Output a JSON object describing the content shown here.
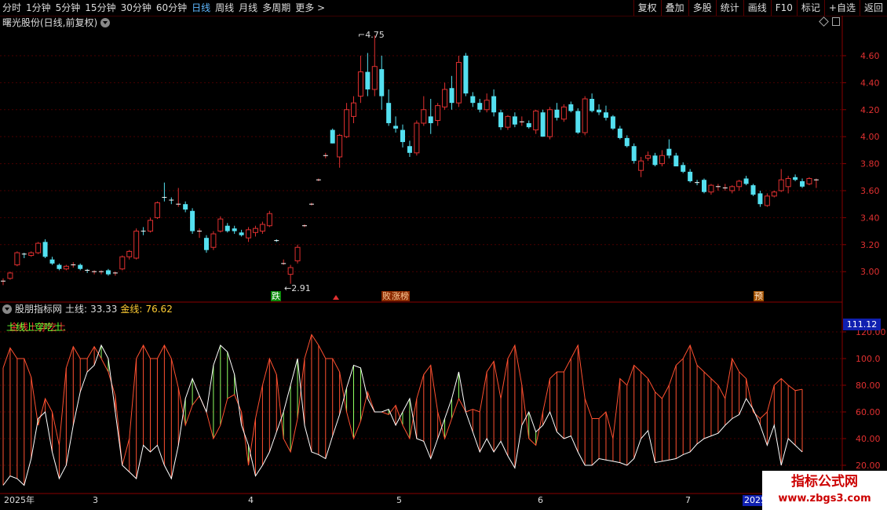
{
  "toolbar": {
    "periods": [
      "分时",
      "1分钟",
      "5分钟",
      "15分钟",
      "30分钟",
      "60分钟",
      "日线",
      "周线",
      "月线",
      "多周期",
      "更多"
    ],
    "active_period": "日线",
    "more_icon": "chevron-right-icon",
    "buttons": [
      "复权",
      "叠加",
      "多股",
      "统计",
      "画线",
      "F10",
      "标记",
      "+自选",
      "返回"
    ]
  },
  "main_chart": {
    "title": "曙光股份(日线,前复权)",
    "high_label": "4.75",
    "low_label": "2.91",
    "y_ticks": [
      "4.60",
      "4.40",
      "4.20",
      "4.00",
      "3.80",
      "3.60",
      "3.40",
      "3.20",
      "3.00"
    ],
    "flags": [
      "跌",
      "败",
      "涨榜",
      "预"
    ]
  },
  "indicator": {
    "name": "股朋指标网",
    "line1_label": "土线:",
    "line1_value": "33.33",
    "line2_label": "金线:",
    "line2_value": "76.62",
    "signal_red": "金线上穿吃土",
    "signal_green": "土线上穿吃土",
    "signal_end": ".",
    "y_ticks": [
      "120.00",
      "100.0",
      "80.00",
      "60.00",
      "40.00",
      "20.00"
    ],
    "current_value": "111.12"
  },
  "x_axis": {
    "labels": [
      "2025年",
      "3",
      "4",
      "5",
      "6",
      "7"
    ],
    "current_date_box": "2025"
  },
  "watermark": {
    "line1": "指标公式网",
    "line2": "www.zbgs3.com"
  },
  "colors": {
    "up": "#e03030",
    "down": "#54e0f0",
    "grid": "#4a0000",
    "green_line": "#90ff60",
    "red_line": "#ff5030"
  },
  "chart_data": [
    {
      "type": "candlestick",
      "title": "曙光股份(日线,前复权)",
      "ylim": [
        2.85,
        4.78
      ],
      "annotations": {
        "max": 4.75,
        "min": 2.91
      },
      "candles": [
        [
          2.92,
          2.95,
          2.9,
          2.93
        ],
        [
          2.95,
          3.0,
          2.94,
          2.99
        ],
        [
          3.05,
          3.15,
          3.04,
          3.14
        ],
        [
          3.13,
          3.14,
          3.1,
          3.12
        ],
        [
          3.12,
          3.15,
          3.11,
          3.14
        ],
        [
          3.14,
          3.22,
          3.13,
          3.21
        ],
        [
          3.22,
          3.24,
          3.1,
          3.11
        ],
        [
          3.09,
          3.11,
          3.05,
          3.06
        ],
        [
          3.05,
          3.06,
          3.01,
          3.02
        ],
        [
          3.02,
          3.05,
          3.01,
          3.04
        ],
        [
          3.04,
          3.07,
          3.03,
          3.05
        ],
        [
          3.05,
          3.06,
          3.01,
          3.02
        ],
        [
          3.01,
          3.02,
          2.99,
          3.0
        ],
        [
          3.0,
          3.01,
          2.98,
          3.0
        ],
        [
          2.99,
          3.01,
          2.98,
          3.0
        ],
        [
          3.01,
          3.02,
          2.97,
          2.98
        ],
        [
          2.98,
          3.0,
          2.97,
          2.99
        ],
        [
          3.02,
          3.12,
          3.01,
          3.11
        ],
        [
          3.11,
          3.16,
          3.09,
          3.15
        ],
        [
          3.1,
          3.32,
          3.09,
          3.3
        ],
        [
          3.3,
          3.33,
          3.27,
          3.29
        ],
        [
          3.3,
          3.4,
          3.29,
          3.38
        ],
        [
          3.4,
          3.52,
          3.39,
          3.51
        ],
        [
          3.55,
          3.66,
          3.52,
          3.54
        ],
        [
          3.53,
          3.55,
          3.5,
          3.52
        ],
        [
          3.5,
          3.62,
          3.48,
          3.5
        ],
        [
          3.5,
          3.52,
          3.44,
          3.46
        ],
        [
          3.45,
          3.47,
          3.28,
          3.3
        ],
        [
          3.3,
          3.32,
          3.25,
          3.3
        ],
        [
          3.25,
          3.27,
          3.14,
          3.16
        ],
        [
          3.18,
          3.3,
          3.16,
          3.28
        ],
        [
          3.3,
          3.41,
          3.29,
          3.39
        ],
        [
          3.34,
          3.36,
          3.29,
          3.3
        ],
        [
          3.32,
          3.34,
          3.28,
          3.3
        ],
        [
          3.29,
          3.31,
          3.26,
          3.27
        ],
        [
          3.25,
          3.33,
          3.22,
          3.31
        ],
        [
          3.29,
          3.34,
          3.26,
          3.32
        ],
        [
          3.3,
          3.37,
          3.28,
          3.35
        ],
        [
          3.34,
          3.45,
          3.33,
          3.43
        ],
        [
          3.23,
          3.24,
          3.22,
          3.22
        ],
        [
          3.06,
          3.09,
          3.05,
          3.06
        ],
        [
          2.98,
          3.05,
          2.91,
          3.03
        ],
        [
          3.08,
          3.2,
          3.06,
          3.18
        ],
        [
          3.34,
          3.35,
          3.33,
          3.34
        ],
        [
          3.5,
          3.51,
          3.49,
          3.5
        ],
        [
          3.68,
          3.69,
          3.67,
          3.68
        ],
        [
          3.85,
          3.88,
          3.84,
          3.86
        ],
        [
          4.05,
          4.06,
          3.95,
          3.95
        ],
        [
          3.85,
          4.02,
          3.77,
          4.01
        ],
        [
          4.0,
          4.25,
          3.99,
          4.2
        ],
        [
          4.15,
          4.3,
          4.1,
          4.25
        ],
        [
          4.3,
          4.6,
          4.25,
          4.48
        ],
        [
          4.48,
          4.62,
          4.3,
          4.35
        ],
        [
          4.35,
          4.75,
          4.3,
          4.52
        ],
        [
          4.5,
          4.6,
          4.2,
          4.3
        ],
        [
          4.25,
          4.35,
          4.08,
          4.1
        ],
        [
          4.08,
          4.15,
          4.03,
          4.06
        ],
        [
          4.05,
          4.09,
          3.92,
          3.96
        ],
        [
          3.93,
          3.97,
          3.85,
          3.88
        ],
        [
          3.88,
          4.12,
          3.86,
          4.1
        ],
        [
          4.1,
          4.3,
          4.08,
          4.2
        ],
        [
          4.15,
          4.28,
          4.02,
          4.1
        ],
        [
          4.12,
          4.25,
          4.08,
          4.23
        ],
        [
          4.22,
          4.4,
          4.2,
          4.35
        ],
        [
          4.36,
          4.45,
          4.2,
          4.25
        ],
        [
          4.25,
          4.6,
          4.22,
          4.55
        ],
        [
          4.6,
          4.62,
          4.3,
          4.32
        ],
        [
          4.3,
          4.33,
          4.22,
          4.25
        ],
        [
          4.25,
          4.28,
          4.18,
          4.2
        ],
        [
          4.2,
          4.32,
          4.18,
          4.27
        ],
        [
          4.3,
          4.35,
          4.15,
          4.18
        ],
        [
          4.18,
          4.2,
          4.05,
          4.07
        ],
        [
          4.07,
          4.16,
          4.05,
          4.15
        ],
        [
          4.15,
          4.18,
          4.07,
          4.09
        ],
        [
          4.1,
          4.15,
          4.08,
          4.11
        ],
        [
          4.1,
          4.12,
          4.06,
          4.07
        ],
        [
          4.05,
          4.2,
          4.02,
          4.19
        ],
        [
          4.18,
          4.2,
          4.0,
          4.0
        ],
        [
          4.0,
          4.22,
          3.98,
          4.2
        ],
        [
          4.2,
          4.25,
          4.12,
          4.14
        ],
        [
          4.13,
          4.24,
          4.11,
          4.22
        ],
        [
          4.24,
          4.26,
          4.18,
          4.19
        ],
        [
          4.19,
          4.21,
          4.02,
          4.03
        ],
        [
          4.03,
          4.3,
          4.01,
          4.28
        ],
        [
          4.28,
          4.32,
          4.18,
          4.19
        ],
        [
          4.2,
          4.24,
          4.16,
          4.18
        ],
        [
          4.18,
          4.23,
          4.12,
          4.14
        ],
        [
          4.15,
          4.16,
          4.05,
          4.06
        ],
        [
          4.06,
          4.08,
          3.98,
          3.99
        ],
        [
          3.99,
          4.01,
          3.92,
          3.93
        ],
        [
          3.93,
          3.95,
          3.8,
          3.82
        ],
        [
          3.75,
          3.85,
          3.7,
          3.82
        ],
        [
          3.84,
          3.89,
          3.82,
          3.86
        ],
        [
          3.86,
          3.88,
          3.78,
          3.79
        ],
        [
          3.8,
          3.9,
          3.78,
          3.86
        ],
        [
          3.91,
          3.98,
          3.84,
          3.86
        ],
        [
          3.86,
          3.88,
          3.78,
          3.78
        ],
        [
          3.79,
          3.81,
          3.73,
          3.74
        ],
        [
          3.74,
          3.76,
          3.66,
          3.67
        ],
        [
          3.66,
          3.68,
          3.64,
          3.65
        ],
        [
          3.68,
          3.69,
          3.58,
          3.59
        ],
        [
          3.59,
          3.65,
          3.57,
          3.64
        ],
        [
          3.62,
          3.65,
          3.6,
          3.63
        ],
        [
          3.62,
          3.65,
          3.6,
          3.62
        ],
        [
          3.6,
          3.64,
          3.58,
          3.63
        ],
        [
          3.63,
          3.68,
          3.6,
          3.67
        ],
        [
          3.69,
          3.71,
          3.64,
          3.65
        ],
        [
          3.64,
          3.65,
          3.56,
          3.57
        ],
        [
          3.58,
          3.6,
          3.48,
          3.5
        ],
        [
          3.49,
          3.58,
          3.48,
          3.56
        ],
        [
          3.56,
          3.6,
          3.55,
          3.59
        ],
        [
          3.6,
          3.76,
          3.59,
          3.68
        ],
        [
          3.63,
          3.71,
          3.58,
          3.69
        ],
        [
          3.7,
          3.72,
          3.67,
          3.68
        ],
        [
          3.67,
          3.69,
          3.62,
          3.63
        ],
        [
          3.65,
          3.7,
          3.64,
          3.69
        ],
        [
          3.67,
          3.69,
          3.62,
          3.68
        ]
      ]
    },
    {
      "type": "line",
      "title": "股朋指标网",
      "ylim": [
        0,
        130
      ],
      "series": [
        {
          "name": "土线",
          "values": [
            93,
            108,
            100,
            100,
            86,
            50,
            70,
            60,
            35,
            93,
            109,
            100,
            100,
            109,
            100,
            90,
            72,
            20,
            40,
            100,
            110,
            100,
            100,
            110,
            100,
            78,
            50,
            65,
            72,
            60,
            40,
            50,
            70,
            73,
            60,
            20,
            55,
            80,
            100,
            88,
            40,
            30,
            55,
            100,
            118,
            110,
            100,
            100,
            90,
            60,
            40,
            53,
            75,
            60,
            60,
            58,
            65,
            50,
            40,
            70,
            88,
            95,
            60,
            40,
            55,
            70,
            60,
            62,
            60,
            90,
            98,
            70,
            100,
            110,
            80,
            40,
            35,
            60,
            85,
            90,
            90,
            100,
            110,
            70,
            55,
            55,
            60,
            40,
            85,
            80,
            95,
            90,
            85,
            75,
            70,
            80,
            95,
            100,
            110,
            95,
            90,
            85,
            80,
            70,
            100,
            90,
            85,
            60,
            55,
            60,
            80,
            85,
            80,
            76,
            77
          ]
        },
        {
          "name": "金线",
          "values": [
            5,
            12,
            10,
            5,
            25,
            55,
            60,
            30,
            10,
            20,
            50,
            75,
            90,
            95,
            110,
            100,
            60,
            20,
            15,
            10,
            35,
            30,
            35,
            20,
            10,
            35,
            70,
            85,
            72,
            60,
            95,
            110,
            105,
            88,
            50,
            35,
            12,
            20,
            30,
            45,
            60,
            80,
            100,
            50,
            30,
            28,
            25,
            42,
            58,
            78,
            95,
            93,
            70,
            60,
            60,
            62,
            50,
            60,
            70,
            40,
            38,
            25,
            40,
            55,
            70,
            90,
            60,
            45,
            30,
            40,
            30,
            38,
            27,
            18,
            50,
            60,
            45,
            50,
            60,
            45,
            40,
            42,
            30,
            20,
            20,
            25,
            24,
            23,
            22,
            20,
            25,
            40,
            46,
            22,
            23,
            24,
            25,
            28,
            30,
            36,
            40,
            42,
            44,
            50,
            55,
            58,
            70,
            62,
            50,
            35,
            50,
            20,
            40,
            35,
            30
          ]
        }
      ]
    }
  ]
}
